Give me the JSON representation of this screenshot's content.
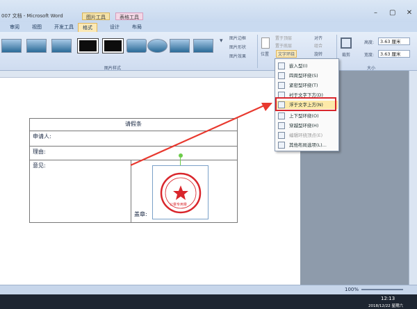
{
  "window": {
    "title": "007 文档 - Microsoft Word",
    "context_tabs": [
      "图片工具",
      "表格工具"
    ],
    "buttons": [
      "–",
      "▢",
      "✕"
    ]
  },
  "tabs": [
    {
      "label": "审阅"
    },
    {
      "label": "视图"
    },
    {
      "label": "开发工具"
    },
    {
      "label": "格式",
      "active": true
    },
    {
      "label": "设计"
    },
    {
      "label": "布局"
    }
  ],
  "ribbon": {
    "picture_styles_label": "图片样式",
    "picture_border": "图片边框",
    "picture_shape": "图片形状",
    "picture_effects": "图片效果",
    "position": "位置",
    "bring_front": "置于顶层",
    "send_back": "置于底层",
    "text_wrap": "文字环绕",
    "align": "对齐",
    "group": "组合",
    "rotate": "旋转",
    "crop": "裁剪",
    "height_label": "高度:",
    "height_value": "3.63 厘米",
    "width_label": "宽度:",
    "width_value": "3.63 厘米",
    "size_label": "大小"
  },
  "wrap_menu": {
    "items": [
      {
        "label": "嵌入型(I)",
        "enabled": true
      },
      {
        "label": "四周型环绕(S)",
        "enabled": true
      },
      {
        "label": "紧密型环绕(T)",
        "enabled": true
      },
      {
        "label": "衬于文字下方(D)",
        "enabled": true
      },
      {
        "label": "浮于文字上方(N)",
        "enabled": true,
        "highlighted": true
      },
      {
        "label": "上下型环绕(O)",
        "enabled": true
      },
      {
        "label": "穿越型环绕(H)",
        "enabled": true
      },
      {
        "label": "编辑环绕顶点(E)",
        "enabled": false
      },
      {
        "label": "其他布局选项(L)...",
        "enabled": true
      }
    ]
  },
  "document": {
    "table": {
      "title": "请假条",
      "applicant": "申请人:",
      "reason": "理由:",
      "opinion": "意见:",
      "stamp_label": "盖章:"
    },
    "seal_text": "公章专用章"
  },
  "status": {
    "zoom": "100%"
  },
  "taskbar": {
    "time": "12:13",
    "date": "2018/12/22 星期六"
  },
  "colors": {
    "accent_red": "#d9262c",
    "seal_red": "#d9262c",
    "active_tab": "#fbe9b6"
  }
}
